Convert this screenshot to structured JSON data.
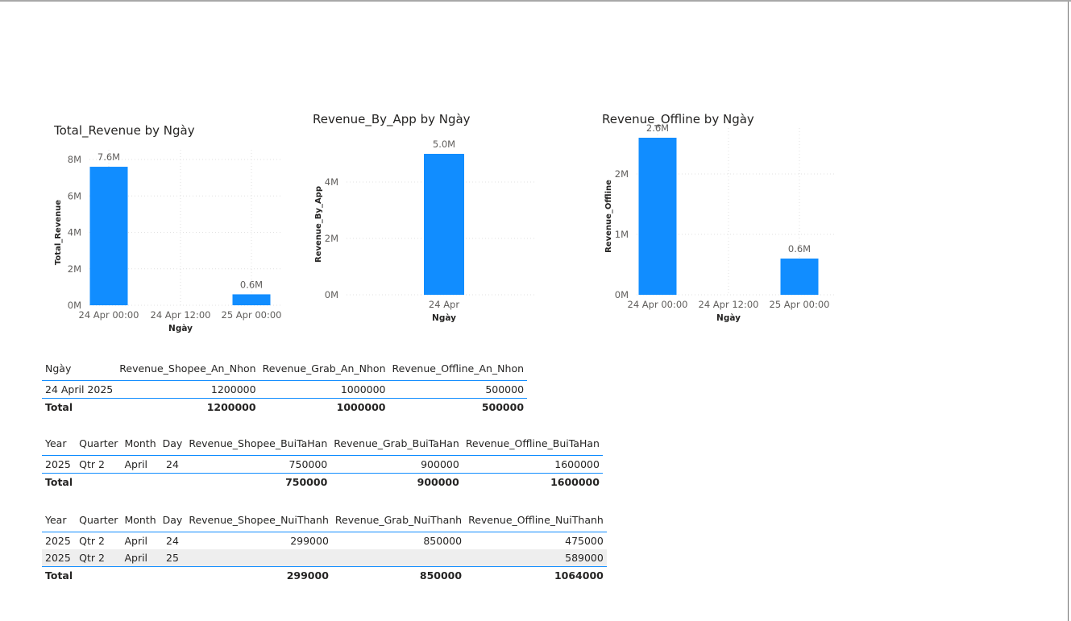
{
  "charts": {
    "total_revenue": {
      "title": "Total_Revenue by Ngày",
      "ylabel": "Total_Revenue",
      "xlabel": "Ngày"
    },
    "by_app": {
      "title": "Revenue_By_App by Ngày",
      "ylabel": "Revenue_By_App",
      "xlabel": "Ngày"
    },
    "offline": {
      "title": "Revenue_Offline by Ngày",
      "ylabel": "Revenue_Offline",
      "xlabel": "Ngày"
    }
  },
  "chart_data": [
    {
      "type": "bar",
      "title": "Total_Revenue by Ngày",
      "xlabel": "Ngày",
      "ylabel": "Total_Revenue",
      "x_ticks": [
        "24 Apr 00:00",
        "24 Apr 12:00",
        "25 Apr 00:00"
      ],
      "y_ticks": [
        "0M",
        "2M",
        "4M",
        "6M",
        "8M"
      ],
      "ylim": [
        0,
        8000000
      ],
      "x": [
        "24 Apr 00:00",
        "25 Apr 00:00"
      ],
      "values": [
        7600000,
        600000
      ],
      "data_labels": [
        "7.6M",
        "0.6M"
      ],
      "bar_color": "#118DFF",
      "grid": true
    },
    {
      "type": "bar",
      "title": "Revenue_By_App by Ngày",
      "xlabel": "Ngày",
      "ylabel": "Revenue_By_App",
      "x_ticks": [
        "24 Apr"
      ],
      "y_ticks": [
        "0M",
        "2M",
        "4M"
      ],
      "ylim": [
        0,
        5000000
      ],
      "x": [
        "24 Apr"
      ],
      "values": [
        5000000
      ],
      "data_labels": [
        "5.0M"
      ],
      "bar_color": "#118DFF",
      "grid": true
    },
    {
      "type": "bar",
      "title": "Revenue_Offline by Ngày",
      "xlabel": "Ngày",
      "ylabel": "Revenue_Offline",
      "x_ticks": [
        "24 Apr 00:00",
        "24 Apr 12:00",
        "25 Apr 00:00"
      ],
      "y_ticks": [
        "0M",
        "1M",
        "2M"
      ],
      "ylim": [
        0,
        2600000
      ],
      "x": [
        "24 Apr 00:00",
        "25 Apr 00:00"
      ],
      "values": [
        2600000,
        600000
      ],
      "data_labels": [
        "2.6M",
        "0.6M"
      ],
      "bar_color": "#118DFF",
      "grid": true
    }
  ],
  "tables": {
    "an_nhon": {
      "headers": [
        "Ngày",
        "Revenue_Shopee_An_Nhon",
        "Revenue_Grab_An_Nhon",
        "Revenue_Offline_An_Nhon"
      ],
      "rows": [
        [
          "24 April 2025",
          "1200000",
          "1000000",
          "500000"
        ]
      ],
      "total": [
        "Total",
        "1200000",
        "1000000",
        "500000"
      ]
    },
    "bui_ta_han": {
      "headers": [
        "Year",
        "Quarter",
        "Month",
        "Day",
        "Revenue_Shopee_BuiTaHan",
        "Revenue_Grab_BuiTaHan",
        "Revenue_Offline_BuiTaHan"
      ],
      "rows": [
        [
          "2025",
          "Qtr 2",
          "April",
          "24",
          "750000",
          "900000",
          "1600000"
        ]
      ],
      "total": [
        "Total",
        "",
        "",
        "",
        "750000",
        "900000",
        "1600000"
      ]
    },
    "nui_thanh": {
      "headers": [
        "Year",
        "Quarter",
        "Month",
        "Day",
        "Revenue_Shopee_NuiThanh",
        "Revenue_Grab_NuiThanh",
        "Revenue_Offline_NuiThanh"
      ],
      "rows": [
        [
          "2025",
          "Qtr 2",
          "April",
          "24",
          "299000",
          "850000",
          "475000"
        ],
        [
          "2025",
          "Qtr 2",
          "April",
          "25",
          "",
          "",
          "589000"
        ]
      ],
      "total": [
        "Total",
        "",
        "",
        "",
        "299000",
        "850000",
        "1064000"
      ]
    }
  }
}
